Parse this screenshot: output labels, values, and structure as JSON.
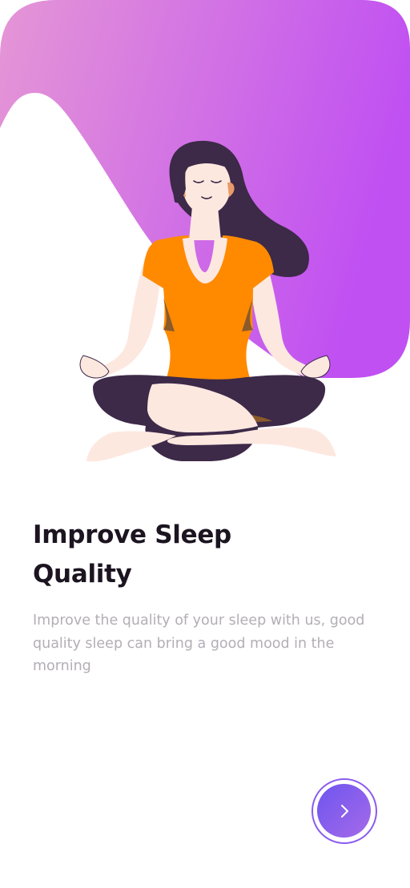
{
  "onboarding": {
    "title_line1": "Improve Sleep",
    "title_line2": "Quality",
    "description": "Improve the quality of your sleep with us, good quality sleep can bring a good mood in the morning",
    "next_button_label": "Next"
  },
  "icons": {
    "next": "chevron-right-icon"
  },
  "colors": {
    "gradient_start": "#e596d6",
    "gradient_end": "#c050f2",
    "button_start": "#6e55ef",
    "button_end": "#a56ae9",
    "title": "#1c1420",
    "description": "#b3aeb6"
  }
}
